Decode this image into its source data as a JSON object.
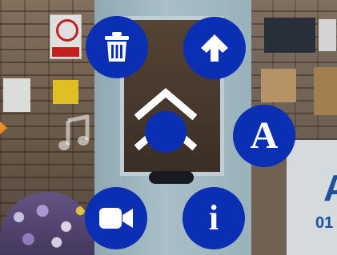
{
  "background": {
    "sign_letter": "A",
    "sign_digits": "01"
  },
  "controls": {
    "text_button_label": "A",
    "info_button_label": "i"
  },
  "icons": {
    "delete": "trash-icon",
    "up": "arrow-up-icon",
    "text": "letter-a-icon",
    "video": "video-camera-icon",
    "info": "info-icon",
    "music": "music-note-icon",
    "center": "chevron-up-icon"
  },
  "colors": {
    "button_fill": "#0a2fb4",
    "icon_fill": "#ffffff",
    "handle": "#f08a24"
  }
}
